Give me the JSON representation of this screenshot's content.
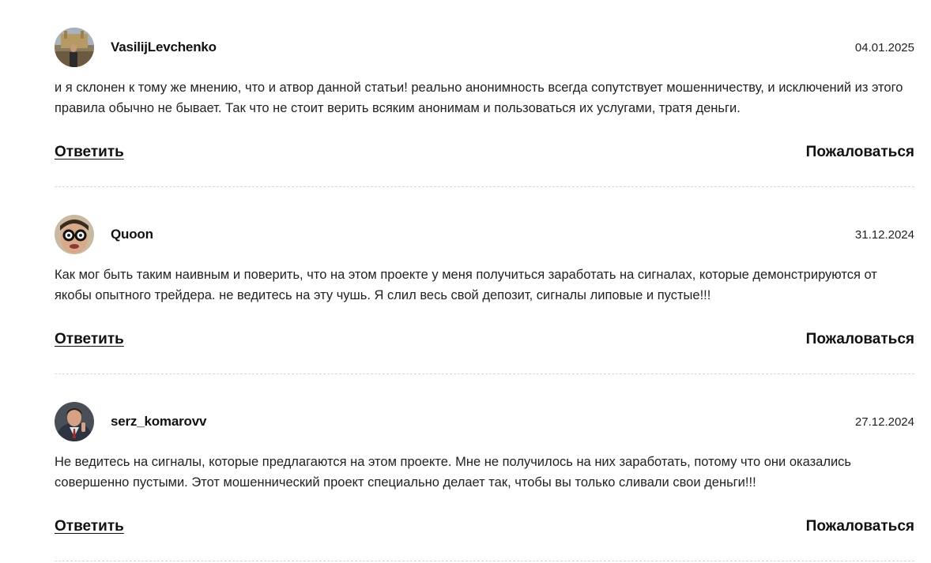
{
  "comments": [
    {
      "username": "VasilijLevchenko",
      "date": "04.01.2025",
      "text": "и я склонен к тому же мнению, что и атвор данной статьи! реально анонимность всегда сопутствует мошенничеству, и исключений из этого правила обычно не бывает. Так что не стоит верить всяким анонимам и пользоваться их услугами, тратя деньги.",
      "reply_label": "Ответить",
      "report_label": "Пожаловаться"
    },
    {
      "username": "Quoon",
      "date": "31.12.2024",
      "text": "Как мог быть таким наивным и поверить, что на этом проекте у меня получиться заработать на сигналах, которые демонстрируются от якобы опытного трейдера. не ведитесь на эту чушь. Я слил весь свой депозит, сигналы липовые и пустые!!!",
      "reply_label": "Ответить",
      "report_label": "Пожаловаться"
    },
    {
      "username": "serz_komarovv",
      "date": "27.12.2024",
      "text": "Не ведитесь на сигналы, которые предлагаются на этом проекте. Мне не получилось на них заработать, потому что они оказались совершенно пустыми. Этот мошеннический проект специально делает так, чтобы вы только сливали свои деньги!!!",
      "reply_label": "Ответить",
      "report_label": "Пожаловаться"
    }
  ]
}
